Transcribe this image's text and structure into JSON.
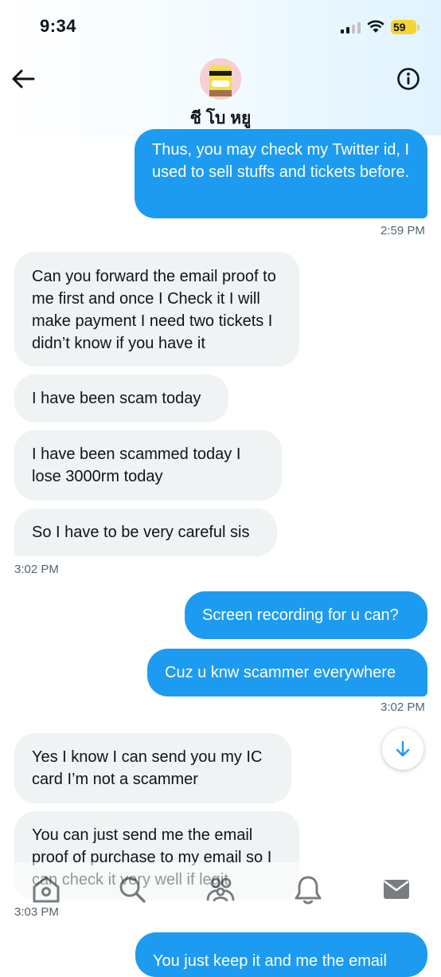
{
  "status_bar": {
    "time": "9:34",
    "battery": "59"
  },
  "header": {
    "contact_name": "ชี โบ หยู",
    "back_icon": "arrow-left-icon",
    "info_icon": "info-icon"
  },
  "messages": [
    {
      "direction": "out",
      "text": "Thus, you may check my Twitter id, I used to sell stuffs and tickets before."
    },
    {
      "timestamp": "2:59 PM"
    },
    {
      "direction": "in",
      "text": "Can you forward the email proof to me first and once I Check it I will make payment I need two tickets I didn’t know if you have it"
    },
    {
      "direction": "in",
      "text": "I have been scam today"
    },
    {
      "direction": "in",
      "text": "I have been  scammed today  I lose 3000rm today"
    },
    {
      "direction": "in",
      "text": "So I have to be very careful sis"
    },
    {
      "timestamp": "3:02 PM"
    },
    {
      "direction": "out",
      "text": "Screen recording for u can?"
    },
    {
      "direction": "out",
      "text": "Cuz u knw scammer everywhere"
    },
    {
      "timestamp": "3:02 PM"
    },
    {
      "direction": "in",
      "text": "Yes I know I can send you my IC card I’m not a scammer"
    },
    {
      "direction": "in",
      "text": "You can just send me the email proof of purchase to my email so I can check it very well if legit"
    },
    {
      "timestamp": "3:03 PM"
    },
    {
      "direction": "out",
      "text": "You just keep it and me the email"
    }
  ],
  "tab_bar": [
    "home-icon",
    "search-icon",
    "communities-icon",
    "notifications-icon",
    "messages-icon"
  ],
  "colors": {
    "accent": "#1d9bf0",
    "incoming_bubble": "#eff3f4",
    "battery": "#f5d531"
  }
}
